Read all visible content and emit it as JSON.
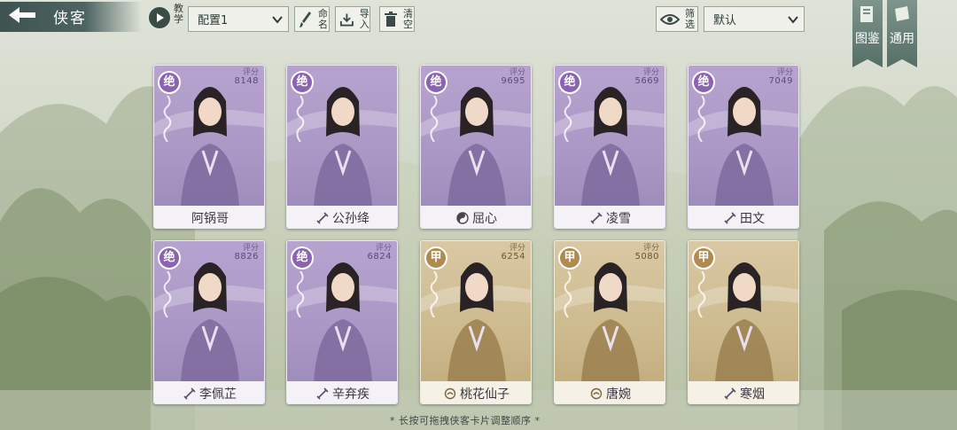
{
  "header": {
    "title": "侠客",
    "teach_label": "教学",
    "preset": "配置1",
    "rename_label": "命名",
    "import_label": "导入",
    "clear_label": "清空",
    "filter_label": "筛选",
    "sort": "默认",
    "side_tabs": [
      {
        "label": "图鉴"
      },
      {
        "label": "通用"
      }
    ]
  },
  "score_label": "评分",
  "cards": [
    {
      "name": "阿锅哥",
      "rank": "绝",
      "score": "8148",
      "tier": "purple",
      "weapon": "none"
    },
    {
      "name": "公孙绛",
      "rank": "绝",
      "score": "",
      "tier": "purple",
      "weapon": "sword"
    },
    {
      "name": "屈心",
      "rank": "绝",
      "score": "9695",
      "tier": "purple",
      "weapon": "taiji"
    },
    {
      "name": "凌雪",
      "rank": "绝",
      "score": "5669",
      "tier": "purple",
      "weapon": "sword"
    },
    {
      "name": "田文",
      "rank": "绝",
      "score": "7049",
      "tier": "purple",
      "weapon": "sword"
    },
    {
      "name": "李佩芷",
      "rank": "绝",
      "score": "8826",
      "tier": "purple",
      "weapon": "sword"
    },
    {
      "name": "辛弃疾",
      "rank": "绝",
      "score": "6824",
      "tier": "purple",
      "weapon": "sword"
    },
    {
      "name": "桃花仙子",
      "rank": "甲",
      "score": "6254",
      "tier": "gold",
      "weapon": "fist"
    },
    {
      "name": "唐婉",
      "rank": "甲",
      "score": "5080",
      "tier": "gold",
      "weapon": "fist"
    },
    {
      "name": "寒烟",
      "rank": "甲",
      "score": "",
      "tier": "gold",
      "weapon": "sword"
    }
  ],
  "footer": {
    "hint": "* 长按可拖拽侠客卡片调整顺序 *"
  },
  "colors": {
    "purple_card": "#a996c4",
    "gold_card": "#ccb98d",
    "header_dark": "#3e5350"
  }
}
